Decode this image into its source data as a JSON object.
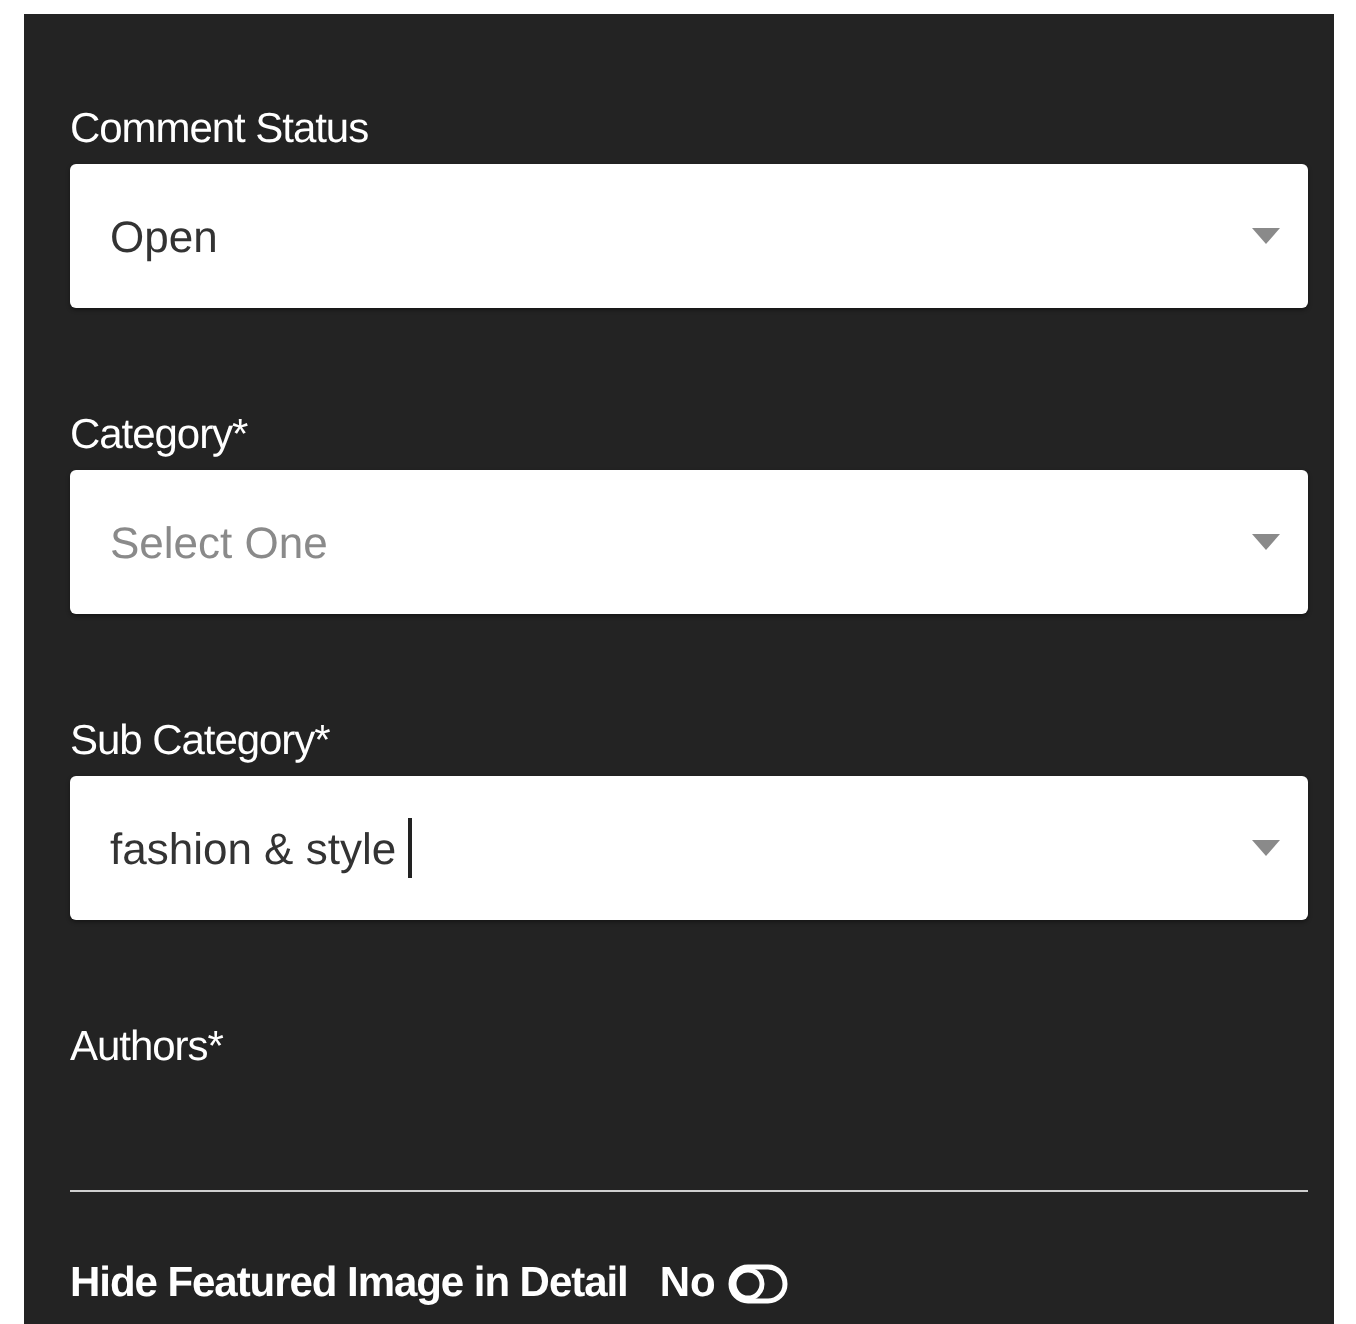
{
  "fields": [
    {
      "label": "Comment Status",
      "kind": "select",
      "value": "Open"
    },
    {
      "label": "Category*",
      "kind": "select",
      "placeholder": "Select One"
    },
    {
      "label": "Sub Category*",
      "kind": "combo",
      "value": "fashion & style",
      "focused": true
    },
    {
      "label": "Authors*",
      "kind": "empty"
    }
  ],
  "toggle": {
    "label": "Hide Featured Image in Detail",
    "value": "No",
    "on": false
  }
}
